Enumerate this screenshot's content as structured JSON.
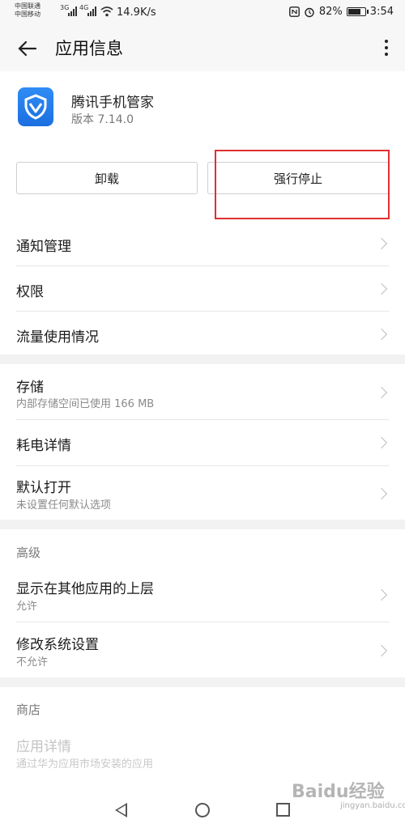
{
  "status_bar": {
    "carrier1": "中国联通",
    "carrier2": "中国移动",
    "sig1": "3G",
    "sig2": "4G",
    "speed": "14.9K/s",
    "battery": "82%",
    "battery_level": 0.82,
    "time": "3:54"
  },
  "app_bar": {
    "title": "应用信息"
  },
  "app": {
    "name": "腾讯手机管家",
    "version": "版本 7.14.0"
  },
  "buttons": {
    "uninstall": "卸载",
    "force_stop": "强行停止"
  },
  "group1": [
    {
      "label": "通知管理"
    },
    {
      "label": "权限"
    },
    {
      "label": "流量使用情况"
    }
  ],
  "group2": [
    {
      "label": "存储",
      "sub": "内部存储空间已使用 166 MB"
    },
    {
      "label": "耗电详情"
    },
    {
      "label": "默认打开",
      "sub": "未设置任何默认选项"
    }
  ],
  "advanced": {
    "title": "高级",
    "items": [
      {
        "label": "显示在其他应用的上层",
        "sub": "允许"
      },
      {
        "label": "修改系统设置",
        "sub": "不允许"
      }
    ]
  },
  "store": {
    "title": "商店",
    "item_label": "应用详情",
    "item_sub": "通过华为应用市场安装的应用"
  },
  "watermark": {
    "text": "Baidu经验",
    "sub": "jingyan.baidu.com"
  },
  "colors": {
    "highlight": "#e03030",
    "icon_blue": "#2f8cf5"
  }
}
